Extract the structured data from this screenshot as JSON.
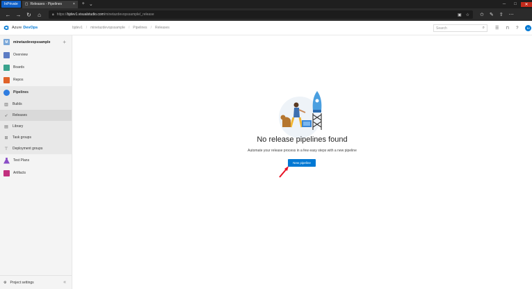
{
  "browser": {
    "inprivate_label": "InPrivate",
    "tab_title": "Releases - Pipelines",
    "tab_close": "×",
    "new_tab": "+",
    "tab_list": "⌄",
    "url_prefix": "https://",
    "url_host": "bjdev1.visualstudio.com",
    "url_path": "/minetazdevopssample/_release"
  },
  "header": {
    "brand_azure": "Azure",
    "brand_devops": "DevOps",
    "breadcrumb": [
      "bjdev1",
      "minetazdevopssample",
      "Pipelines",
      "Releases"
    ],
    "search_placeholder": "Search",
    "avatar_initials": "BJ"
  },
  "sidebar": {
    "project_initial": "M",
    "project_name": "minetazdevopssample",
    "items": [
      {
        "label": "Overview"
      },
      {
        "label": "Boards"
      },
      {
        "label": "Repos"
      },
      {
        "label": "Pipelines"
      },
      {
        "label": "Builds"
      },
      {
        "label": "Releases"
      },
      {
        "label": "Library"
      },
      {
        "label": "Task groups"
      },
      {
        "label": "Deployment groups"
      },
      {
        "label": "Test Plans"
      },
      {
        "label": "Artifacts"
      }
    ],
    "footer_label": "Project settings"
  },
  "main": {
    "empty_title": "No release pipelines found",
    "empty_description": "Automate your release process in a few easy steps with a new pipeline",
    "new_pipeline_label": "New pipeline"
  },
  "colors": {
    "accent": "#0078d4",
    "annotation_arrow": "#e81123"
  }
}
